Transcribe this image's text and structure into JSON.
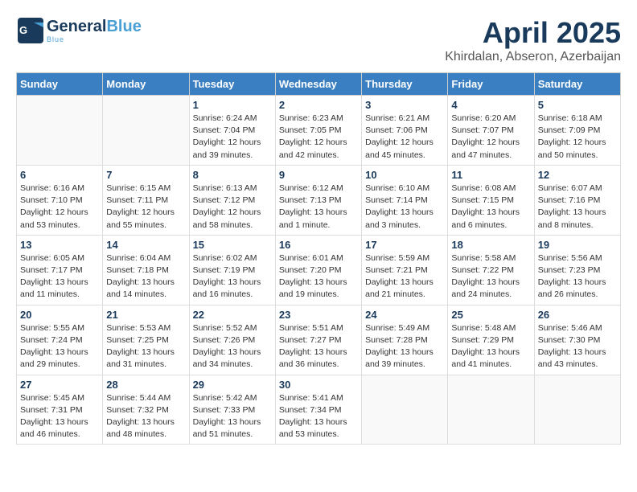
{
  "header": {
    "logo_general": "General",
    "logo_blue": "Blue",
    "month": "April 2025",
    "location": "Khirdalan, Abseron, Azerbaijan"
  },
  "days_of_week": [
    "Sunday",
    "Monday",
    "Tuesday",
    "Wednesday",
    "Thursday",
    "Friday",
    "Saturday"
  ],
  "weeks": [
    [
      {
        "day": "",
        "info": ""
      },
      {
        "day": "",
        "info": ""
      },
      {
        "day": "1",
        "info": "Sunrise: 6:24 AM\nSunset: 7:04 PM\nDaylight: 12 hours and 39 minutes."
      },
      {
        "day": "2",
        "info": "Sunrise: 6:23 AM\nSunset: 7:05 PM\nDaylight: 12 hours and 42 minutes."
      },
      {
        "day": "3",
        "info": "Sunrise: 6:21 AM\nSunset: 7:06 PM\nDaylight: 12 hours and 45 minutes."
      },
      {
        "day": "4",
        "info": "Sunrise: 6:20 AM\nSunset: 7:07 PM\nDaylight: 12 hours and 47 minutes."
      },
      {
        "day": "5",
        "info": "Sunrise: 6:18 AM\nSunset: 7:09 PM\nDaylight: 12 hours and 50 minutes."
      }
    ],
    [
      {
        "day": "6",
        "info": "Sunrise: 6:16 AM\nSunset: 7:10 PM\nDaylight: 12 hours and 53 minutes."
      },
      {
        "day": "7",
        "info": "Sunrise: 6:15 AM\nSunset: 7:11 PM\nDaylight: 12 hours and 55 minutes."
      },
      {
        "day": "8",
        "info": "Sunrise: 6:13 AM\nSunset: 7:12 PM\nDaylight: 12 hours and 58 minutes."
      },
      {
        "day": "9",
        "info": "Sunrise: 6:12 AM\nSunset: 7:13 PM\nDaylight: 13 hours and 1 minute."
      },
      {
        "day": "10",
        "info": "Sunrise: 6:10 AM\nSunset: 7:14 PM\nDaylight: 13 hours and 3 minutes."
      },
      {
        "day": "11",
        "info": "Sunrise: 6:08 AM\nSunset: 7:15 PM\nDaylight: 13 hours and 6 minutes."
      },
      {
        "day": "12",
        "info": "Sunrise: 6:07 AM\nSunset: 7:16 PM\nDaylight: 13 hours and 8 minutes."
      }
    ],
    [
      {
        "day": "13",
        "info": "Sunrise: 6:05 AM\nSunset: 7:17 PM\nDaylight: 13 hours and 11 minutes."
      },
      {
        "day": "14",
        "info": "Sunrise: 6:04 AM\nSunset: 7:18 PM\nDaylight: 13 hours and 14 minutes."
      },
      {
        "day": "15",
        "info": "Sunrise: 6:02 AM\nSunset: 7:19 PM\nDaylight: 13 hours and 16 minutes."
      },
      {
        "day": "16",
        "info": "Sunrise: 6:01 AM\nSunset: 7:20 PM\nDaylight: 13 hours and 19 minutes."
      },
      {
        "day": "17",
        "info": "Sunrise: 5:59 AM\nSunset: 7:21 PM\nDaylight: 13 hours and 21 minutes."
      },
      {
        "day": "18",
        "info": "Sunrise: 5:58 AM\nSunset: 7:22 PM\nDaylight: 13 hours and 24 minutes."
      },
      {
        "day": "19",
        "info": "Sunrise: 5:56 AM\nSunset: 7:23 PM\nDaylight: 13 hours and 26 minutes."
      }
    ],
    [
      {
        "day": "20",
        "info": "Sunrise: 5:55 AM\nSunset: 7:24 PM\nDaylight: 13 hours and 29 minutes."
      },
      {
        "day": "21",
        "info": "Sunrise: 5:53 AM\nSunset: 7:25 PM\nDaylight: 13 hours and 31 minutes."
      },
      {
        "day": "22",
        "info": "Sunrise: 5:52 AM\nSunset: 7:26 PM\nDaylight: 13 hours and 34 minutes."
      },
      {
        "day": "23",
        "info": "Sunrise: 5:51 AM\nSunset: 7:27 PM\nDaylight: 13 hours and 36 minutes."
      },
      {
        "day": "24",
        "info": "Sunrise: 5:49 AM\nSunset: 7:28 PM\nDaylight: 13 hours and 39 minutes."
      },
      {
        "day": "25",
        "info": "Sunrise: 5:48 AM\nSunset: 7:29 PM\nDaylight: 13 hours and 41 minutes."
      },
      {
        "day": "26",
        "info": "Sunrise: 5:46 AM\nSunset: 7:30 PM\nDaylight: 13 hours and 43 minutes."
      }
    ],
    [
      {
        "day": "27",
        "info": "Sunrise: 5:45 AM\nSunset: 7:31 PM\nDaylight: 13 hours and 46 minutes."
      },
      {
        "day": "28",
        "info": "Sunrise: 5:44 AM\nSunset: 7:32 PM\nDaylight: 13 hours and 48 minutes."
      },
      {
        "day": "29",
        "info": "Sunrise: 5:42 AM\nSunset: 7:33 PM\nDaylight: 13 hours and 51 minutes."
      },
      {
        "day": "30",
        "info": "Sunrise: 5:41 AM\nSunset: 7:34 PM\nDaylight: 13 hours and 53 minutes."
      },
      {
        "day": "",
        "info": ""
      },
      {
        "day": "",
        "info": ""
      },
      {
        "day": "",
        "info": ""
      }
    ]
  ]
}
